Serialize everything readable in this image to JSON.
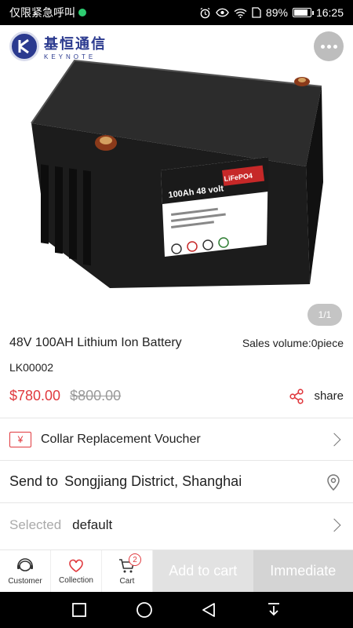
{
  "status_bar": {
    "carrier": "仅限紧急呼叫",
    "battery": "89%",
    "battery_level": 0.89,
    "time": "16:25",
    "icons": [
      "alarm-icon",
      "eye-icon",
      "wifi-icon",
      "battery-icon"
    ]
  },
  "header": {
    "logo_cn": "基恒通信",
    "logo_en": "KEYNOTE",
    "more_icon": "more-dots-icon"
  },
  "gallery": {
    "counter": "1/1",
    "label_brand": "100Ah 48 volt",
    "label_chem": "LiFePO4"
  },
  "product": {
    "title": "48V 100AH Lithium Ion Battery",
    "sales_volume": "Sales volume:0piece",
    "sku": "LK00002",
    "price": "$780.00",
    "original_price": "$800.00",
    "share_label": "share"
  },
  "voucher": {
    "icon_text": "¥",
    "label": "Collar Replacement Voucher"
  },
  "shipping": {
    "label": "Send to",
    "location": "Songjiang District, Shanghai"
  },
  "spec": {
    "label": "Selected",
    "value": "default"
  },
  "bottom_bar": {
    "customer": "Customer",
    "collection": "Collection",
    "cart": "Cart",
    "cart_count": "2",
    "add_to_cart": "Add to cart",
    "buy_now": "Immediate"
  },
  "colors": {
    "accent": "#e0393e",
    "brand": "#2b3a8f"
  }
}
